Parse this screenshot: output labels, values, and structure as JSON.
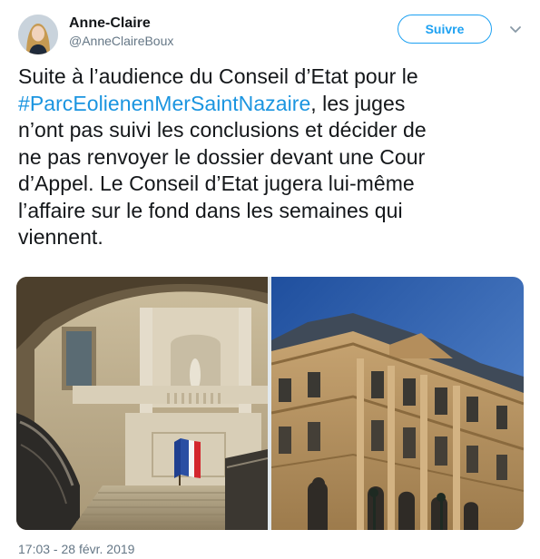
{
  "author": {
    "name": "Anne-Claire",
    "handle": "@AnneClaireBoux"
  },
  "follow_button": {
    "label": "Suivre"
  },
  "tweet": {
    "lines": [
      "Suite à l’audience du Conseil d’Etat pour le",
      ", les juges",
      "n’ont pas suivi les conclusions et décider de",
      "ne pas renvoyer le dossier devant une Cour",
      "d’Appel. Le Conseil d’Etat jugera lui-même",
      "l’affaire sur le fond dans les semaines qui",
      "viennent."
    ],
    "hashtag": "#ParcEolienenMerSaintNazaire"
  },
  "media": {
    "photos": [
      {
        "subject": "interior-staircase-with-flags"
      },
      {
        "subject": "palais-royal-facade"
      }
    ]
  },
  "timestamp": "17:03 - 28 févr. 2019",
  "colors": {
    "link": "#1b95e0",
    "follow": "#1da1f2",
    "secondary_text": "#657786",
    "sky": "#2f5fa8"
  },
  "icons": {
    "more": "chevron-down-icon"
  }
}
